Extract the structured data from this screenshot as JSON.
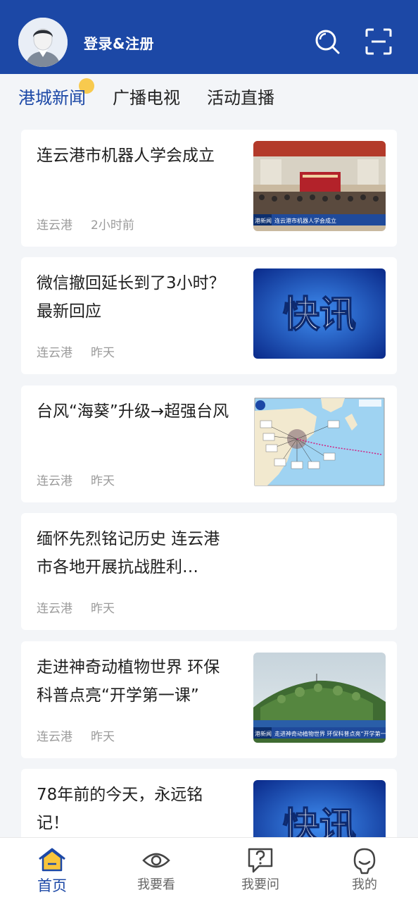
{
  "header": {
    "login_label": "登录&注册",
    "colors": {
      "brand": "#1c48a6"
    },
    "icons": [
      "search-icon",
      "scan-icon"
    ]
  },
  "tabs": [
    {
      "label": "港城新闻",
      "active": true
    },
    {
      "label": "广播电视",
      "active": false
    },
    {
      "label": "活动直播",
      "active": false
    }
  ],
  "feed": [
    {
      "title": "连云港市机器人学会成立",
      "source": "连云港",
      "time": "2小时前",
      "thumb": {
        "type": "news-photo",
        "caption": "连云港市机器人学会成立",
        "logo": "港新闻"
      }
    },
    {
      "title": "微信撤回延长到了3小时？最新回应",
      "source": "连云港",
      "time": "昨天",
      "thumb": {
        "type": "flash-banner",
        "text": "快讯"
      }
    },
    {
      "title": "台风“海葵”升级→超强台风",
      "source": "连云港",
      "time": "昨天",
      "thumb": {
        "type": "typhoon-map"
      }
    },
    {
      "title": "缅怀先烈铭记历史 连云港市各地开展抗战胜利…",
      "source": "连云港",
      "time": "昨天",
      "thumb": null
    },
    {
      "title": "走进神奇动植物世界 环保科普点亮“开学第一课”",
      "source": "连云港",
      "time": "昨天",
      "thumb": {
        "type": "news-photo",
        "caption": "走进神奇动植物世界 环保科普点亮“开学第一课”",
        "logo": "港新闻"
      }
    },
    {
      "title": "78年前的今天，永远铭记！",
      "source": "",
      "time": "",
      "thumb": {
        "type": "flash-banner",
        "text": "快讯"
      }
    }
  ],
  "bottom_nav": [
    {
      "label": "首页",
      "icon": "home-icon",
      "active": true
    },
    {
      "label": "我要看",
      "icon": "eye-icon",
      "active": false
    },
    {
      "label": "我要问",
      "icon": "question-icon",
      "active": false
    },
    {
      "label": "我的",
      "icon": "profile-icon",
      "active": false
    }
  ]
}
